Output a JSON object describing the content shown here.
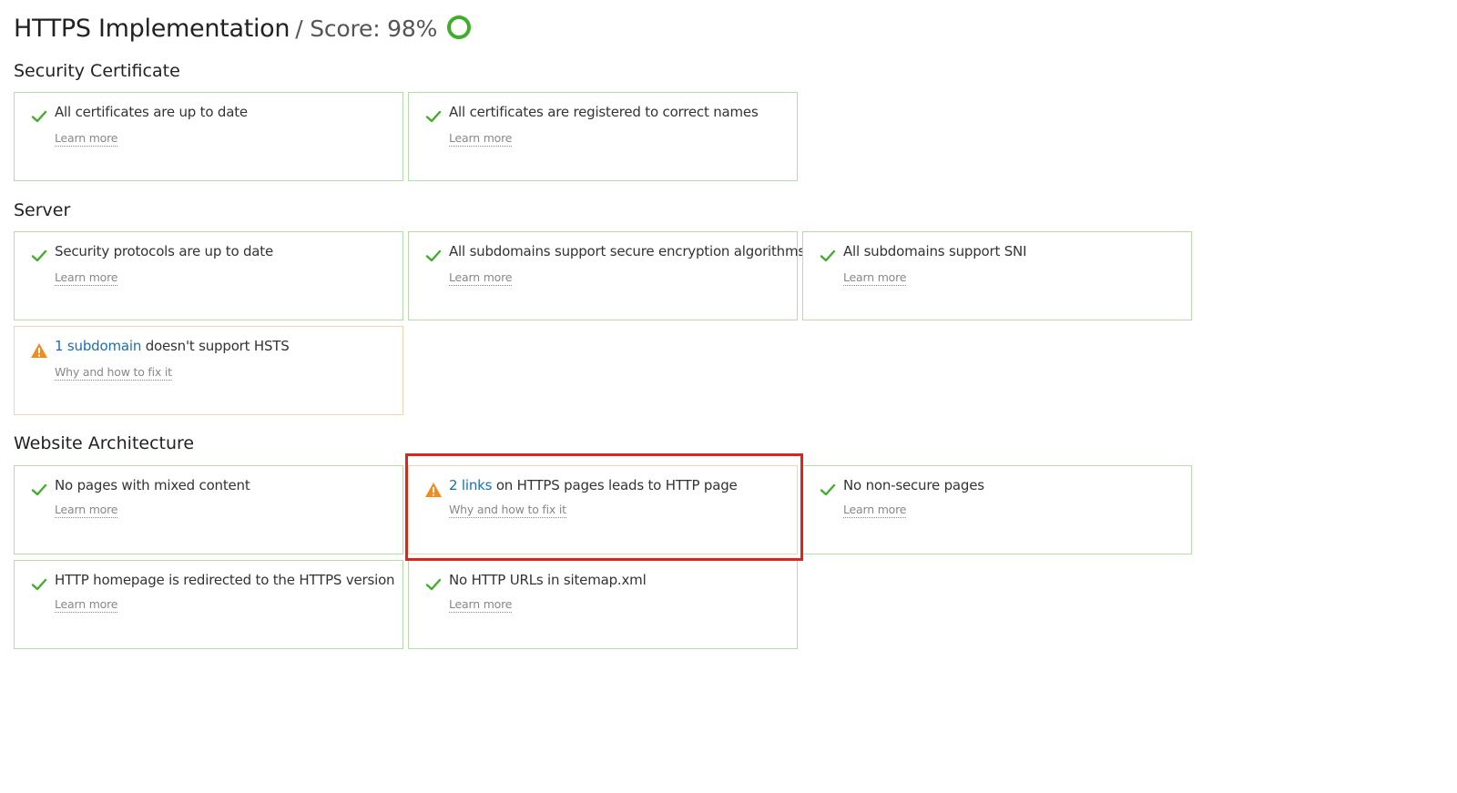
{
  "header": {
    "title": "HTTPS Implementation",
    "score": "/ Score: 98%",
    "score_ring_color": "#3fae29"
  },
  "colors": {
    "ok_check": "#3fae29",
    "warning": "#f28c1e",
    "link": "#1a6fb3",
    "ok_border": "#b7dcaa",
    "warn_border": "#f5d3ae",
    "highlight": "#e2231a"
  },
  "sections": {
    "security_certificate": {
      "title": "Security Certificate",
      "cards": [
        {
          "status": "ok",
          "icon": "check-icon",
          "text": "All certificates are up to date",
          "more": "Learn more"
        },
        {
          "status": "ok",
          "icon": "check-icon",
          "text": "All certificates are registered to correct names",
          "more": "Learn more"
        }
      ]
    },
    "server": {
      "title": "Server",
      "cards": [
        {
          "status": "ok",
          "icon": "check-icon",
          "text": "Security protocols are up to date",
          "more": "Learn more"
        },
        {
          "status": "ok",
          "icon": "check-icon",
          "text": "All subdomains support secure encryption algorithms",
          "more": "Learn more"
        },
        {
          "status": "ok",
          "icon": "check-icon",
          "text": "All subdomains support SNI",
          "more": "Learn more"
        },
        {
          "status": "warning",
          "icon": "warning-icon",
          "link": "1 subdomain",
          "text": " doesn't support HSTS",
          "more": "Why and how to fix it"
        }
      ]
    },
    "website_architecture": {
      "title": "Website Architecture",
      "cards": [
        {
          "status": "ok",
          "icon": "check-icon",
          "text": "No pages with mixed content",
          "more": "Learn more"
        },
        {
          "status": "warning",
          "icon": "warning-icon",
          "link": "2 links",
          "text": " on HTTPS pages leads to HTTP page",
          "more": "Why and how to fix it"
        },
        {
          "status": "ok",
          "icon": "check-icon",
          "text": "No non-secure pages",
          "more": "Learn more"
        },
        {
          "status": "ok",
          "icon": "check-icon",
          "text": "HTTP homepage is redirected to the HTTPS version",
          "more": "Learn more"
        },
        {
          "status": "ok",
          "icon": "check-icon",
          "text": "No HTTP URLs in sitemap.xml",
          "more": "Learn more"
        }
      ]
    }
  }
}
